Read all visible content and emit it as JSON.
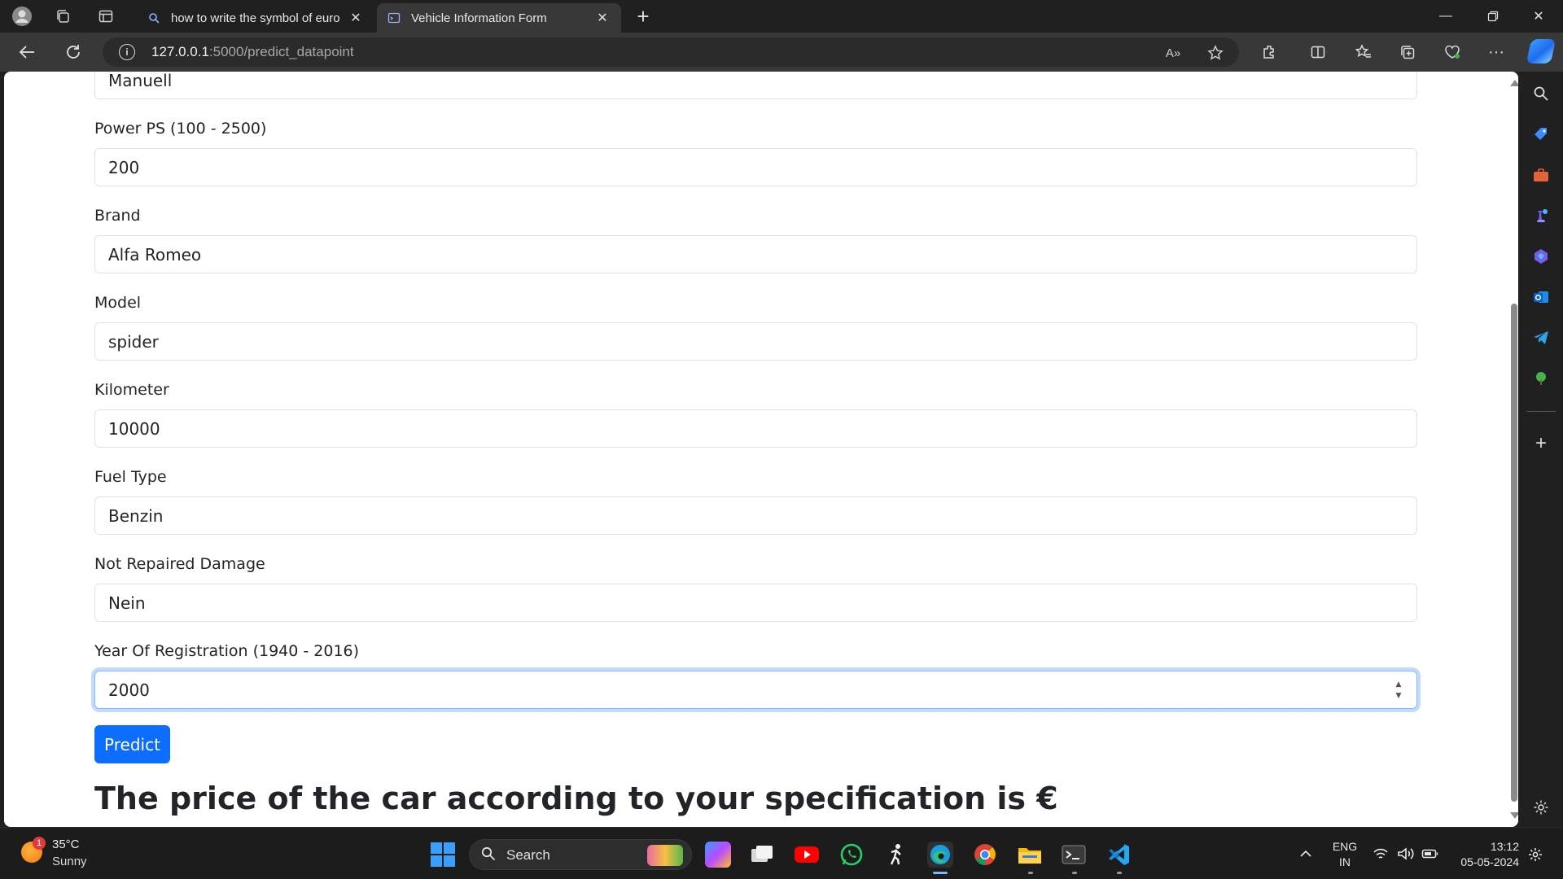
{
  "browser": {
    "tabs": [
      {
        "title": "how to write the symbol of euro",
        "active": false
      },
      {
        "title": "Vehicle Information Form",
        "active": true
      }
    ],
    "url_host": "127.0.0.1",
    "url_path": ":5000/predict_datapoint",
    "read_aloud_label": "A»"
  },
  "form": {
    "fields": [
      {
        "label": "",
        "value": "Manuell"
      },
      {
        "label": "Power PS (100 - 2500)",
        "value": "200"
      },
      {
        "label": "Brand",
        "value": "Alfa Romeo"
      },
      {
        "label": "Model",
        "value": "spider"
      },
      {
        "label": "Kilometer",
        "value": "10000"
      },
      {
        "label": "Fuel Type",
        "value": "Benzin"
      },
      {
        "label": "Not Repaired Damage",
        "value": "Nein"
      },
      {
        "label": "Year Of Registration (1940 - 2016)",
        "value": "2000"
      }
    ],
    "submit_label": "Predict",
    "result_text": "The price of the car according to your specification is €"
  },
  "taskbar": {
    "weather_temp": "35°C",
    "weather_desc": "Sunny",
    "weather_badge": "1",
    "search_label": "Search",
    "lang_line1": "ENG",
    "lang_line2": "IN",
    "time": "13:12",
    "date": "05-05-2024"
  },
  "colors": {
    "primary_button": "#0d6efd",
    "focus_ring": "#86b7fe",
    "browser_chrome": "#202020",
    "address_bar": "#383838"
  }
}
